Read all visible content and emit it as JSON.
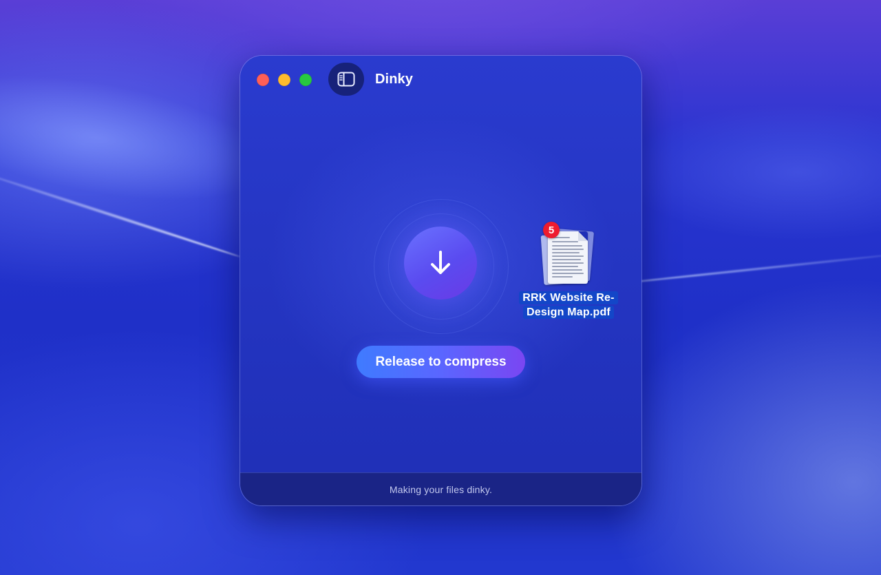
{
  "window": {
    "title": "Dinky"
  },
  "drop_zone": {
    "action_label": "Release to compress"
  },
  "footer": {
    "status": "Making your files dinky."
  },
  "dragged_file": {
    "name_line1": "RRK Website Re-",
    "name_line2": "Design Map.pdf",
    "count": "5"
  },
  "icons": {
    "sidebar_toggle": "sidebar-icon",
    "drop": "arrow-down-icon",
    "file": "pdf-document-icon"
  },
  "colors": {
    "close": "#ff5f57",
    "minimize": "#febc2e",
    "zoom": "#28c840",
    "badge": "#ee1c2e",
    "accent_start": "#3f7bff",
    "accent_end": "#7a46f2"
  }
}
